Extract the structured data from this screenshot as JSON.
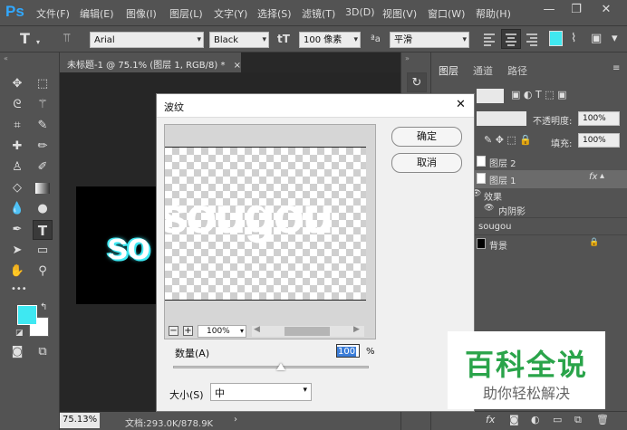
{
  "app": {
    "logo": "Ps"
  },
  "menu": [
    "文件(F)",
    "编辑(E)",
    "图像(I)",
    "图层(L)",
    "文字(Y)",
    "选择(S)",
    "滤镜(T)",
    "3D(D)",
    "视图(V)",
    "窗口(W)",
    "帮助(H)"
  ],
  "window_controls": {
    "minimize": "—",
    "restore": "❐",
    "close": "✕"
  },
  "options": {
    "tool_glyph": "T",
    "font_family": "Arial",
    "font_style": "Black",
    "font_size": "100 像素",
    "aa_label": "ªa",
    "antialias": "平滑",
    "color": "#40e8f0"
  },
  "document": {
    "tab_title": "未标题-1 @ 75.1% (图层 1, RGB/8) *",
    "tab_close": "×",
    "art_text": "so",
    "zoom": "75.13%",
    "doc_info": "文档:293.0K/878.9K"
  },
  "tools": {
    "fg_color": "#3ee8f2",
    "bg_color": "#ffffff",
    "dots": "•••"
  },
  "layers_panel": {
    "tabs": [
      "图层",
      "通道",
      "路径"
    ],
    "opacity_label": "不透明度:",
    "opacity": "100%",
    "fill_label": "填充:",
    "fill": "100%",
    "rows": [
      {
        "name": "图层 2"
      },
      {
        "name": "图层 1",
        "fx": "fx"
      },
      {
        "name": "效果"
      },
      {
        "name": "内阴影"
      },
      {
        "name": "sougou"
      },
      {
        "name": "背景"
      }
    ],
    "bottom_icons": [
      "fx"
    ]
  },
  "dialog": {
    "title": "波纹",
    "close": "✕",
    "ok": "确定",
    "cancel": "取消",
    "preview_text": "sougou",
    "zoom": "100%",
    "zoom_minus": "−",
    "zoom_plus": "+",
    "amount_label": "数量(A)",
    "amount": "100",
    "amount_unit": "%",
    "amount_value": 100,
    "amount_range": [
      -999,
      999
    ],
    "size_label": "大小(S)",
    "size": "中"
  },
  "watermark": {
    "title": "百科全说",
    "subtitle": "助你轻松解决"
  },
  "colors": {
    "accent_cyan": "#3ee8f2",
    "watermark_green": "#2aa44a"
  }
}
